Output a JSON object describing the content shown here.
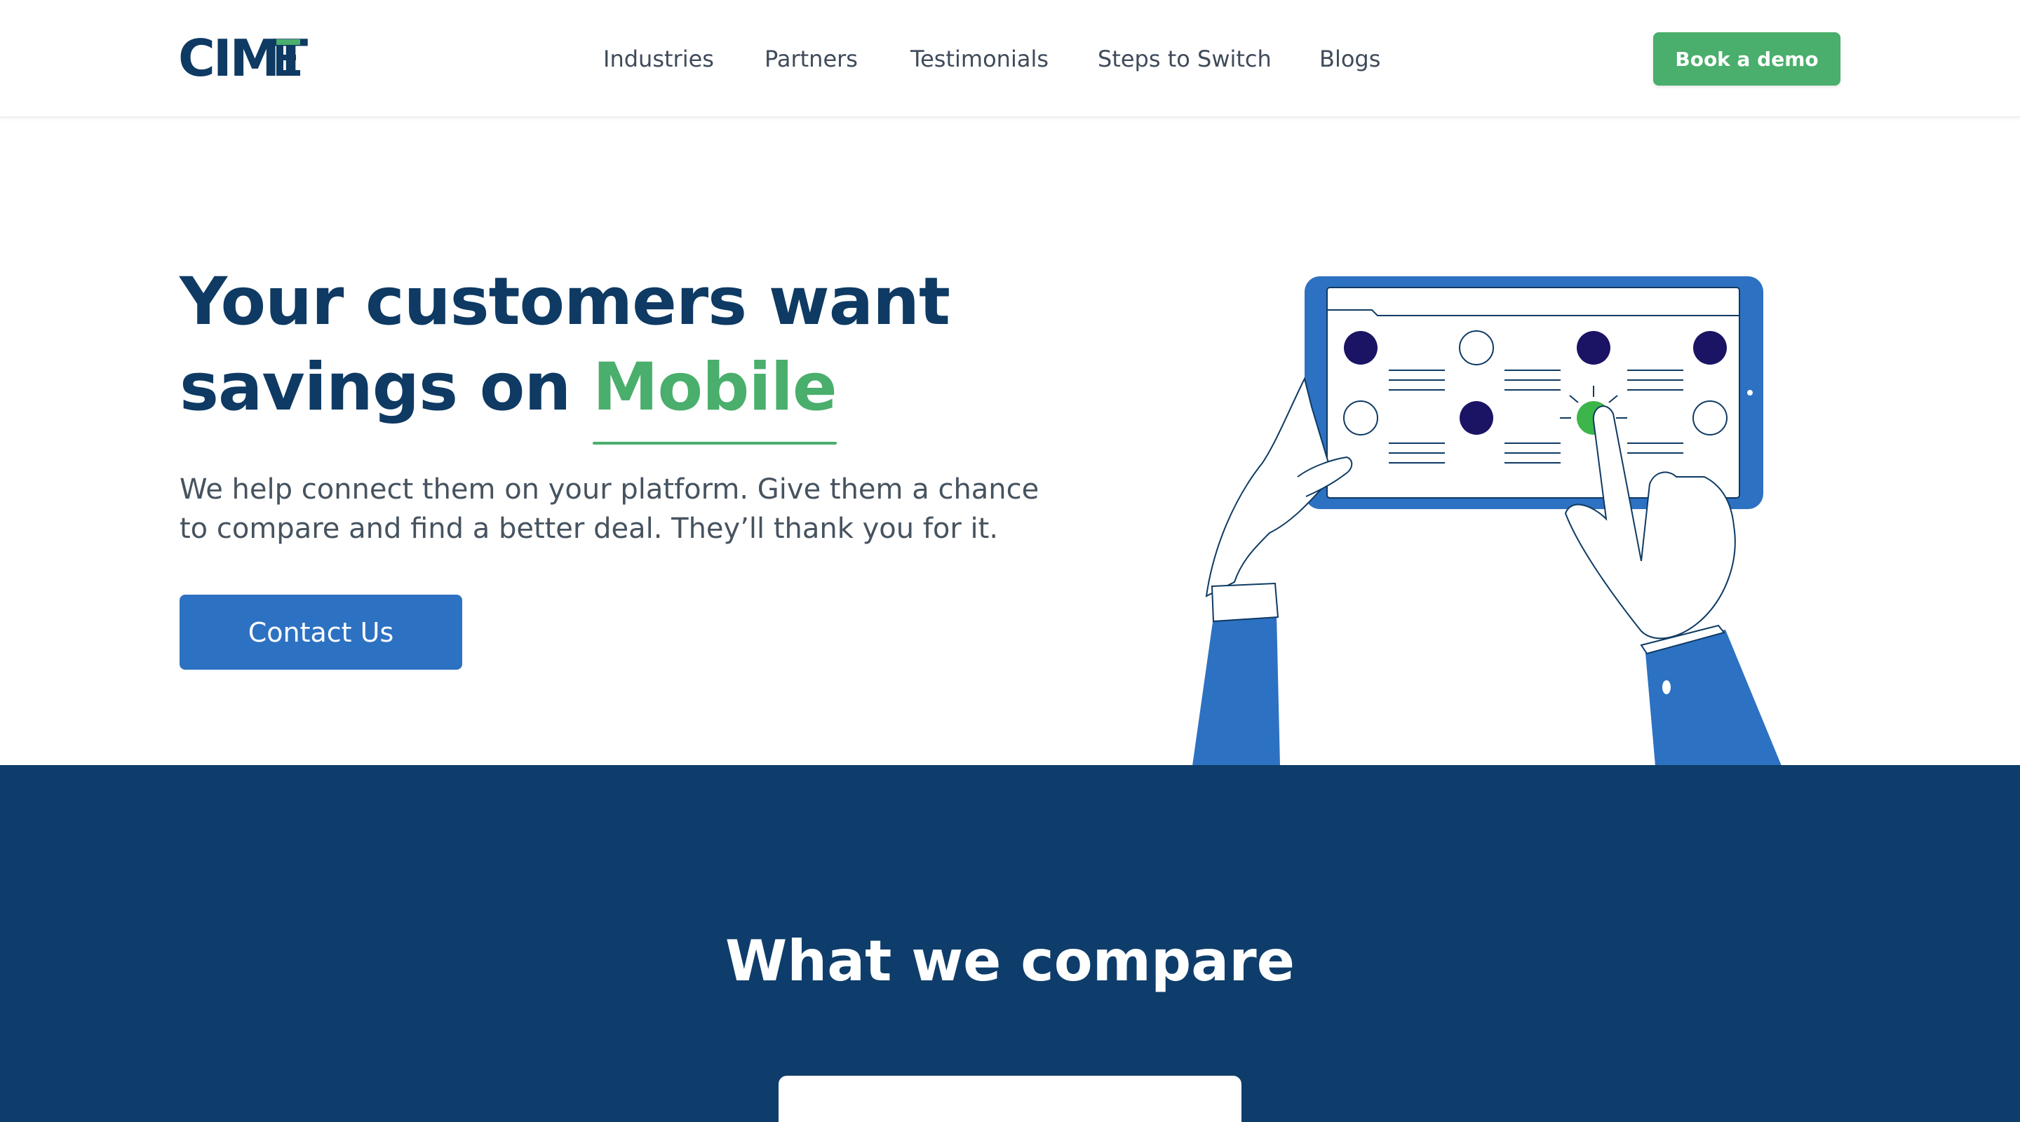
{
  "header": {
    "logo_text": "CIMET",
    "nav": [
      "Industries",
      "Partners",
      "Testimonials",
      "Steps to Switch",
      "Blogs"
    ],
    "demo_button": "Book a demo"
  },
  "hero": {
    "title_line1": "Your customers want",
    "title_line2_prefix": "savings on",
    "title_accent": "Mobile",
    "subtitle": "We help connect them on your platform. Give them a chance to compare and find a better deal. They’ll thank you for it.",
    "cta": "Contact Us"
  },
  "compare": {
    "title": "What we compare"
  },
  "colors": {
    "navy": "#0e3a63",
    "green": "#4aae6c",
    "blue_button": "#2d71c2",
    "section_bg": "#0e3d6b"
  },
  "icons": [
    "tablet-illustration"
  ]
}
